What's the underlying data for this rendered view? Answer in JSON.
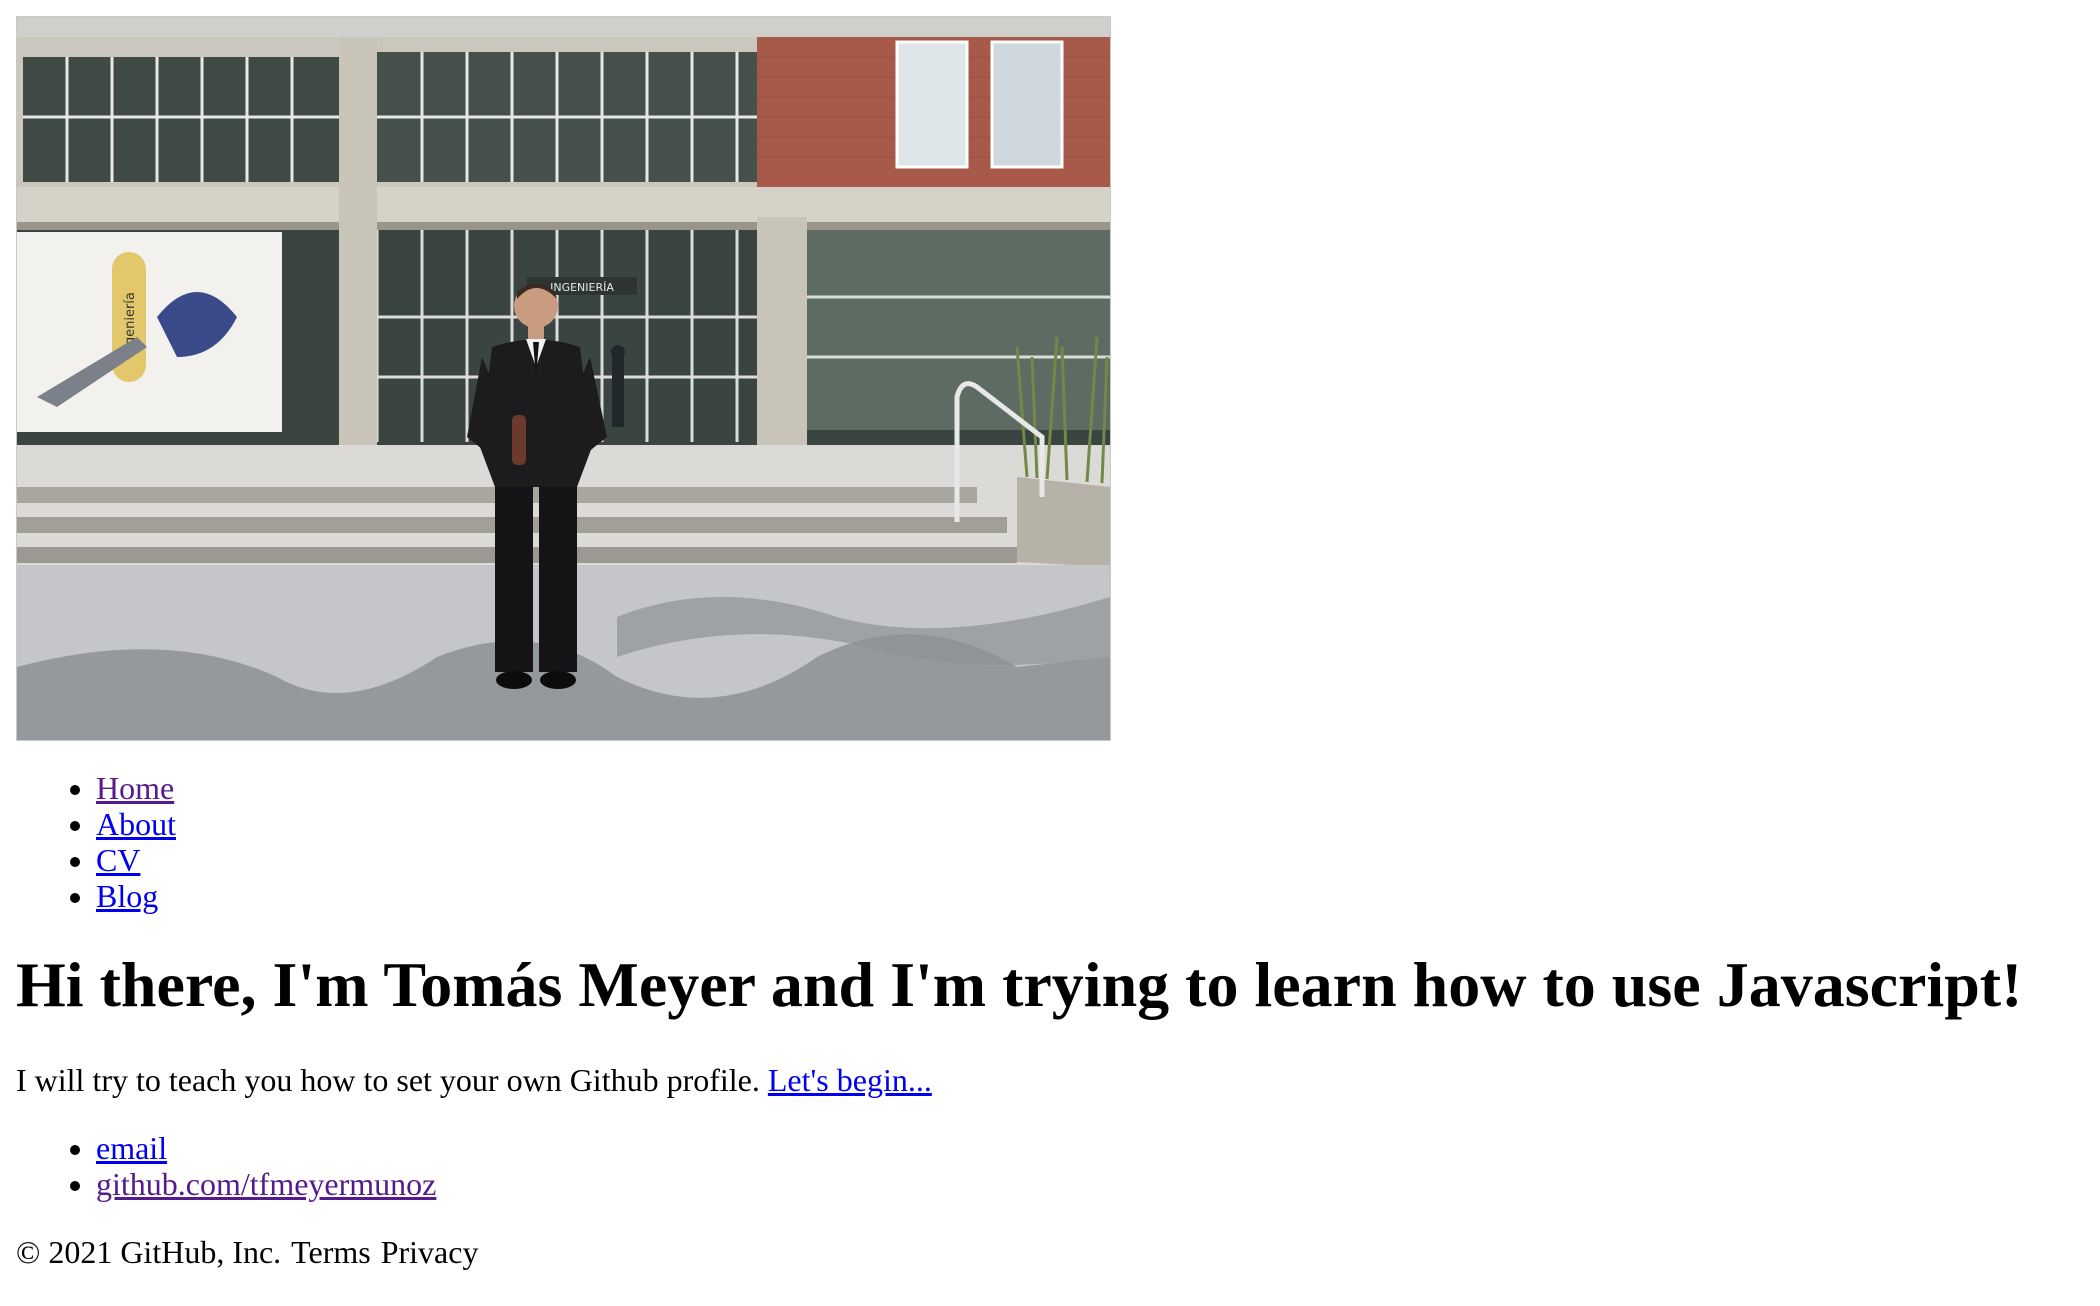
{
  "nav": {
    "items": [
      {
        "label": "Home"
      },
      {
        "label": "About"
      },
      {
        "label": "CV"
      },
      {
        "label": "Blog"
      }
    ]
  },
  "headline": "Hi there, I'm Tomás Meyer and I'm trying to learn how to use Javascript!",
  "intro": {
    "text": "I will try to teach you how to set your own Github profile.",
    "link_label": "Let's begin..."
  },
  "contacts": {
    "items": [
      {
        "label": "email"
      },
      {
        "label": "github.com/tfmeyermunoz"
      }
    ]
  },
  "footer": {
    "copyright": "© 2021 GitHub, Inc.",
    "terms": "Terms",
    "privacy": "Privacy"
  },
  "photo": {
    "banner_text": "ingeniería",
    "sign_text": "INGENIERÍA"
  },
  "colors": {
    "link_unvisited": "#0000ee",
    "link_visited": "#551a8b",
    "text": "#000000",
    "background": "#ffffff"
  }
}
